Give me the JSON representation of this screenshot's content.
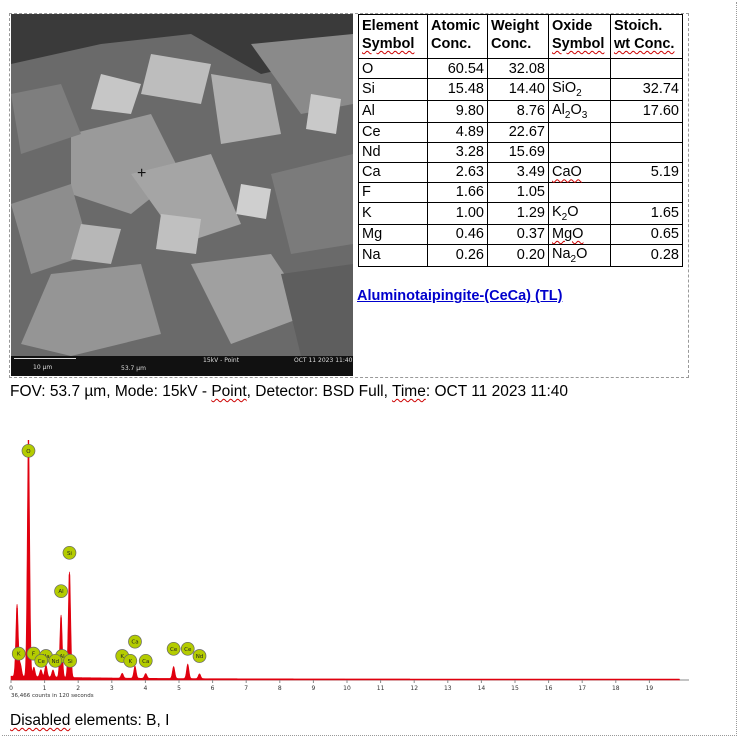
{
  "image": {
    "scale_label": "10 µm",
    "fov_label": "53.7 µm",
    "mode_label": "15kV - Point",
    "date_label": "OCT 11 2023 11:40"
  },
  "table": {
    "headers": [
      [
        "Element",
        "Symbol"
      ],
      [
        "Atomic",
        "Conc."
      ],
      [
        "Weight",
        "Conc."
      ],
      [
        "Oxide",
        "Symbol"
      ],
      [
        "Stoich.",
        "wt Conc."
      ]
    ],
    "rows": [
      {
        "element": "O",
        "atomic": "60.54",
        "weight": "32.08",
        "oxide_base": "",
        "oxide_sub1": "",
        "oxide_mid": "",
        "oxide_sub2": "",
        "stoich": ""
      },
      {
        "element": "Si",
        "atomic": "15.48",
        "weight": "14.40",
        "oxide_base": "SiO",
        "oxide_sub1": "",
        "oxide_mid": "",
        "oxide_sub2": "2",
        "stoich": "32.74"
      },
      {
        "element": "Al",
        "atomic": "9.80",
        "weight": "8.76",
        "oxide_base": "Al",
        "oxide_sub1": "2",
        "oxide_mid": "O",
        "oxide_sub2": "3",
        "stoich": "17.60"
      },
      {
        "element": "Ce",
        "atomic": "4.89",
        "weight": "22.67",
        "oxide_base": "",
        "oxide_sub1": "",
        "oxide_mid": "",
        "oxide_sub2": "",
        "stoich": ""
      },
      {
        "element": "Nd",
        "atomic": "3.28",
        "weight": "15.69",
        "oxide_base": "",
        "oxide_sub1": "",
        "oxide_mid": "",
        "oxide_sub2": "",
        "stoich": ""
      },
      {
        "element": "Ca",
        "atomic": "2.63",
        "weight": "3.49",
        "oxide_base": "CaO",
        "oxide_sub1": "",
        "oxide_mid": "",
        "oxide_sub2": "",
        "stoich": "5.19"
      },
      {
        "element": "F",
        "atomic": "1.66",
        "weight": "1.05",
        "oxide_base": "",
        "oxide_sub1": "",
        "oxide_mid": "",
        "oxide_sub2": "",
        "stoich": ""
      },
      {
        "element": "K",
        "atomic": "1.00",
        "weight": "1.29",
        "oxide_base": "K",
        "oxide_sub1": "2",
        "oxide_mid": "O",
        "oxide_sub2": "",
        "stoich": "1.65"
      },
      {
        "element": "Mg",
        "atomic": "0.46",
        "weight": "0.37",
        "oxide_base": "MgO",
        "oxide_sub1": "",
        "oxide_mid": "",
        "oxide_sub2": "",
        "stoich": "0.65"
      },
      {
        "element": "Na",
        "atomic": "0.26",
        "weight": "0.20",
        "oxide_base": "Na",
        "oxide_sub1": "2",
        "oxide_mid": "O",
        "oxide_sub2": "",
        "stoich": "0.28"
      }
    ]
  },
  "mineral_link": "Aluminotaipingite-(CeCa) (TL)",
  "fov": {
    "prefix": "FOV: 53.7 µm, Mode: 15kV - ",
    "point": "Point",
    "mid": ", Detector: BSD Full, ",
    "time": "Time",
    "suffix": ": OCT 11 2023 11:40"
  },
  "disabled": {
    "word": "Disabled",
    "rest": " elements: B, I"
  },
  "chart_data": {
    "type": "area",
    "title": "",
    "xlabel": "",
    "ylabel": "",
    "xlim": [
      0,
      20
    ],
    "x_ticks": [
      "0",
      "1",
      "2",
      "3",
      "4",
      "5",
      "6",
      "7",
      "8",
      "9",
      "10",
      "11",
      "12",
      "13",
      "14",
      "15",
      "16",
      "17",
      "18",
      "19"
    ],
    "counts_note": "36,466 counts in 120 seconds",
    "peak_color": "#e0000f",
    "marker_color": "#b4cc00",
    "peaks": [
      {
        "energy": 0.18,
        "height": 0.3
      },
      {
        "energy": 0.28,
        "height": 0.05
      },
      {
        "energy": 0.52,
        "height": 1.0
      },
      {
        "energy": 0.68,
        "height": 0.04
      },
      {
        "energy": 0.89,
        "height": 0.03
      },
      {
        "energy": 1.04,
        "height": 0.05
      },
      {
        "energy": 1.25,
        "height": 0.03
      },
      {
        "energy": 1.49,
        "height": 0.26
      },
      {
        "energy": 1.74,
        "height": 0.44
      },
      {
        "energy": 3.31,
        "height": 0.02
      },
      {
        "energy": 3.69,
        "height": 0.05
      },
      {
        "energy": 4.01,
        "height": 0.02
      },
      {
        "energy": 4.84,
        "height": 0.05
      },
      {
        "energy": 5.26,
        "height": 0.06
      },
      {
        "energy": 5.61,
        "height": 0.02
      }
    ],
    "labels": [
      {
        "text": "O",
        "energy": 0.52,
        "level": 0.955
      },
      {
        "text": "Si",
        "energy": 1.74,
        "level": 0.53
      },
      {
        "text": "Al",
        "energy": 1.49,
        "level": 0.37
      },
      {
        "text": "K",
        "energy": 0.23,
        "level": 0.11
      },
      {
        "text": "F",
        "energy": 0.67,
        "level": 0.11
      },
      {
        "text": "Na",
        "energy": 1.04,
        "level": 0.1
      },
      {
        "text": "Ce",
        "energy": 0.9,
        "level": 0.08
      },
      {
        "text": "Al",
        "energy": 1.52,
        "level": 0.1
      },
      {
        "text": "Nd",
        "energy": 1.32,
        "level": 0.08
      },
      {
        "text": "Si",
        "energy": 1.76,
        "level": 0.08
      },
      {
        "text": "Ca",
        "energy": 3.69,
        "level": 0.16
      },
      {
        "text": "K",
        "energy": 3.31,
        "level": 0.1
      },
      {
        "text": "K",
        "energy": 3.55,
        "level": 0.08
      },
      {
        "text": "Ca",
        "energy": 4.01,
        "level": 0.08
      },
      {
        "text": "Ce",
        "energy": 4.84,
        "level": 0.13
      },
      {
        "text": "Ce",
        "energy": 5.26,
        "level": 0.13
      },
      {
        "text": "Nd",
        "energy": 5.61,
        "level": 0.1
      }
    ]
  }
}
